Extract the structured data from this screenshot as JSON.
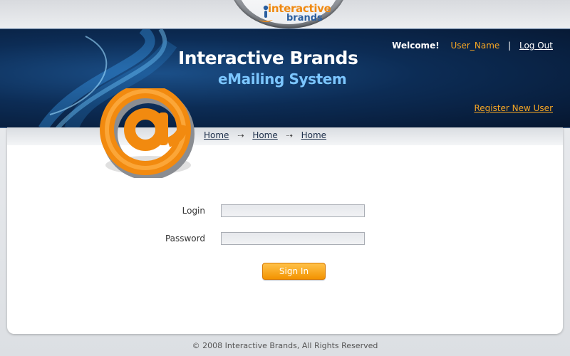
{
  "logo": {
    "line1": "interactive",
    "line2": "brands"
  },
  "header": {
    "title": "Interactive Brands",
    "subtitle": "eMailing System",
    "welcome": "Welcome!",
    "user_name": "User_Name",
    "separator": "|",
    "logout_label": "Log Out",
    "register_label": "Register New User"
  },
  "breadcrumb": {
    "items": [
      "Home",
      "Home",
      "Home"
    ],
    "arrow": "⇢"
  },
  "form": {
    "login_label": "Login",
    "login_value": "",
    "password_label": "Password",
    "password_value": "",
    "signin_label": "Sign In"
  },
  "footer": {
    "copyright": "© 2008 Interactive Brands, All Rights Reserved"
  },
  "colors": {
    "accent_orange": "#f6a623",
    "header_blue": "#0c2c55",
    "subtitle_blue": "#7cc6ff"
  }
}
